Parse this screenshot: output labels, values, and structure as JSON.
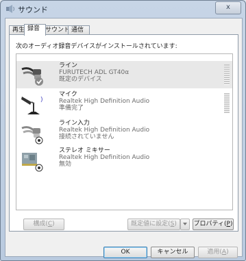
{
  "window": {
    "title": "サウンド",
    "close_glyph": "x"
  },
  "tabs": [
    {
      "label": "再生",
      "active": false
    },
    {
      "label": "録音",
      "active": true
    },
    {
      "label": "サウンド",
      "active": false
    },
    {
      "label": "通信",
      "active": false
    }
  ],
  "panel": {
    "instruction": "次のオーディオ録音デバイスがインストールされています:",
    "devices": [
      {
        "name": "ライン",
        "driver": "FURUTECH ADL GT40α",
        "status": "既定のデバイス",
        "icon": "line-in-default-icon",
        "selected": true,
        "meter": true
      },
      {
        "name": "マイク",
        "driver": "Realtek High Definition Audio",
        "status": "準備完了",
        "icon": "microphone-icon",
        "selected": false,
        "meter": true
      },
      {
        "name": "ライン入力",
        "driver": "Realtek High Definition Audio",
        "status": "接続されていません",
        "icon": "line-in-disconnected-icon",
        "selected": false,
        "meter": false
      },
      {
        "name": "ステレオ ミキサー",
        "driver": "Realtek High Definition Audio",
        "status": "無効",
        "icon": "stereo-mixer-disabled-icon",
        "selected": false,
        "meter": false
      }
    ],
    "buttons": {
      "configure": {
        "label": "構成(",
        "key": "C",
        "suffix": ")"
      },
      "set_default": {
        "label": "既定値に設定(",
        "key": "S",
        "suffix": ")"
      },
      "properties": {
        "label": "プロパティ(",
        "key": "P",
        "suffix": ")"
      }
    }
  },
  "footer": {
    "ok": "OK",
    "cancel": "キャンセル",
    "apply": {
      "label": "適用(",
      "key": "A",
      "suffix": ")"
    }
  }
}
